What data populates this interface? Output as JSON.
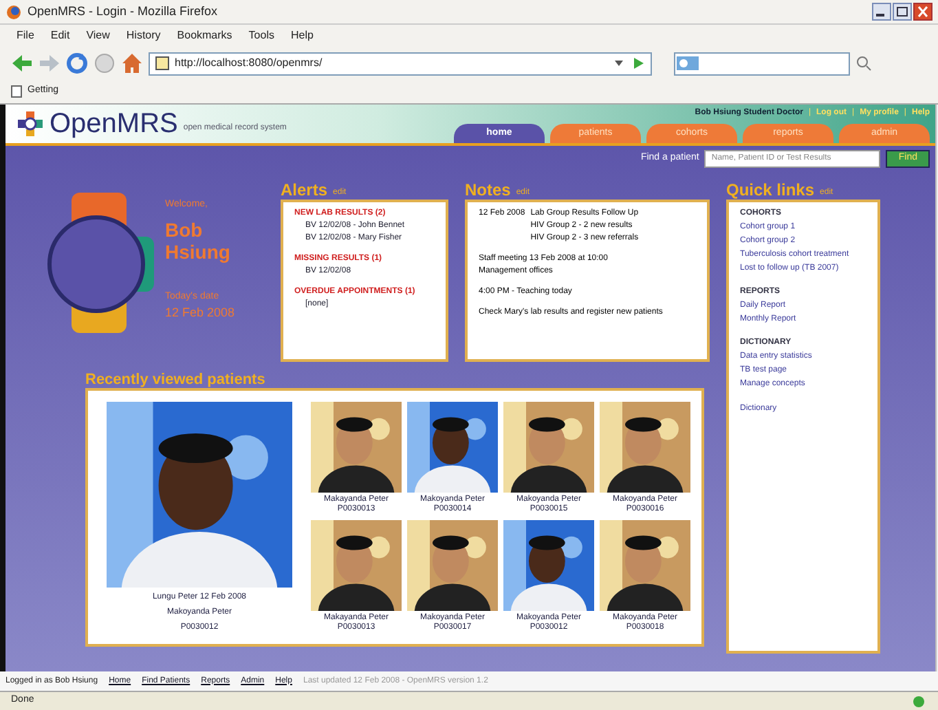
{
  "window": {
    "title": "OpenMRS - Login - Mozilla Firefox"
  },
  "menu": [
    "File",
    "Edit",
    "View",
    "History",
    "Bookmarks",
    "Tools",
    "Help"
  ],
  "toolbar": {
    "address": "http://localhost:8080/openmrs/"
  },
  "bookmarks": [
    "Getting"
  ],
  "header": {
    "app_name": "OpenMRS",
    "tagline": "open medical record system",
    "user_links": [
      "Bob Hsiung Student Doctor",
      "Log out",
      "My profile",
      "Help"
    ],
    "separator": "|",
    "tabs": [
      {
        "label": "home",
        "selected": true
      },
      {
        "label": "patients",
        "selected": false
      },
      {
        "label": "cohorts",
        "selected": false
      },
      {
        "label": "reports",
        "selected": false
      },
      {
        "label": "admin",
        "selected": false
      }
    ]
  },
  "search": {
    "label": "Find a patient",
    "placeholder": "Name, Patient ID or Test Results",
    "button": "Find"
  },
  "welcome": {
    "greeting": "Welcome,",
    "first": "Bob",
    "last": "Hsiung",
    "date_label": "Today's date",
    "date": "12 Feb 2008"
  },
  "alerts": {
    "title": "Alerts",
    "edit": "edit",
    "groups": [
      {
        "heading": "NEW LAB RESULTS (2)",
        "items": [
          "BV 12/02/08 - John Bennet",
          "BV 12/02/08 - Mary Fisher"
        ]
      },
      {
        "heading": "MISSING RESULTS (1)",
        "items": [
          "BV 12/02/08"
        ]
      },
      {
        "heading": "OVERDUE APPOINTMENTS (1)",
        "items": [
          "[none]"
        ]
      }
    ]
  },
  "notes": {
    "title": "Notes",
    "edit": "edit",
    "entries": [
      {
        "lead": "12 Feb 2008",
        "lines": [
          "Lab Group Results Follow Up",
          "HIV Group 2 - 2 new results",
          "HIV Group 2 - 3 new referrals"
        ]
      },
      {
        "lines": [
          "Staff meeting 13 Feb 2008 at 10:00",
          "Management offices"
        ]
      },
      {
        "lines": [
          "4:00 PM - Teaching today"
        ]
      },
      {
        "lines": [
          "Check Mary's lab results and register new patients"
        ]
      }
    ]
  },
  "quick_links": {
    "title": "Quick links",
    "edit": "edit",
    "sections": [
      {
        "heading": "COHORTS",
        "links": [
          "Cohort group 1",
          "Cohort group 2",
          "Tuberculosis cohort treatment",
          "Lost to follow up (TB 2007)"
        ]
      },
      {
        "heading": "REPORTS",
        "links": [
          "Daily Report",
          "Monthly Report"
        ]
      },
      {
        "heading": "DICTIONARY",
        "links": [
          "Data entry statistics",
          "TB test page",
          "Manage concepts"
        ]
      },
      {
        "links": [
          "Dictionary"
        ]
      }
    ]
  },
  "patients": {
    "title": "Recently viewed patients",
    "items": [
      {
        "name": "Lungu Peter 12 Feb 2008",
        "sub": "Makoyanda Peter",
        "id": "P0030012"
      },
      {
        "name": "Makayanda Peter",
        "id": "P0030013"
      },
      {
        "name": "Makoyanda Peter",
        "id": "P0030014"
      },
      {
        "name": "Makoyanda Peter",
        "id": "P0030015"
      },
      {
        "name": "Makoyanda Peter",
        "id": "P0030016"
      },
      {
        "name": "Makayanda Peter",
        "id": "P0030013"
      },
      {
        "name": "Makoyanda Peter",
        "id": "P0030017"
      },
      {
        "name": "Makoyanda Peter",
        "id": "P0030012"
      },
      {
        "name": "Makoyanda Peter",
        "id": "P0030018"
      }
    ]
  },
  "footer": {
    "text": "Logged in as Bob Hsiung",
    "links": [
      "Home",
      "Find Patients",
      "Reports",
      "Admin",
      "Help"
    ],
    "note": "Last updated 12 Feb 2008 - OpenMRS version 1.2"
  },
  "status_bar": {
    "text": "Done"
  }
}
